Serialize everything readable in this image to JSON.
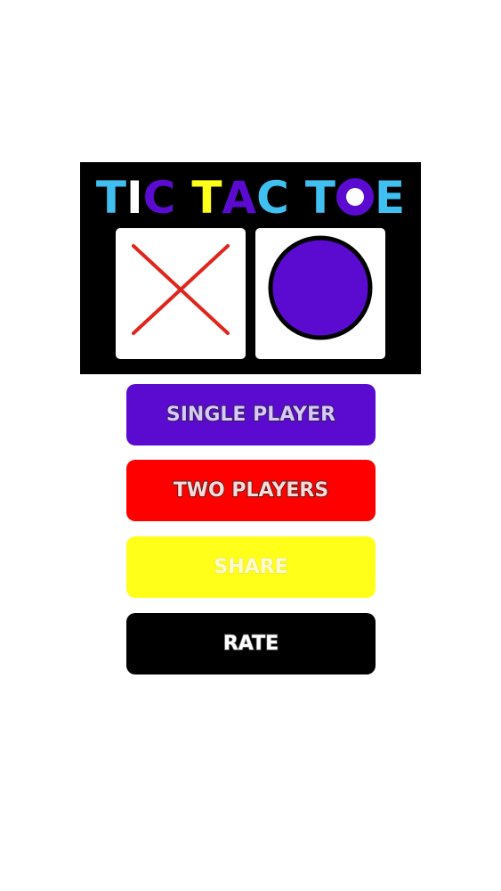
{
  "logo": {
    "title_letters": [
      {
        "char": "T",
        "color": "#3fc0f0"
      },
      {
        "char": "I",
        "color": "#ffffff"
      },
      {
        "char": "C",
        "color": "#5b0bd0"
      },
      {
        "char": "T",
        "color": "#ffff1a"
      },
      {
        "char": "A",
        "color": "#5b0bd0"
      },
      {
        "char": "C",
        "color": "#3fc0f0"
      },
      {
        "char": "T",
        "color": "#3fc0f0"
      },
      {
        "char": "O",
        "color": "#5b0bd0"
      },
      {
        "char": "E",
        "color": "#3fc0f0"
      }
    ],
    "word1": [
      "T",
      "I",
      "C"
    ],
    "word2": [
      "T",
      "A",
      "C"
    ],
    "word3": [
      "T",
      "O",
      "E"
    ],
    "tile_x_icon": "x-mark-icon",
    "tile_o_icon": "circle-mark-icon",
    "colors": {
      "x_mark": "#e0261c",
      "o_mark": "#5b0bd0",
      "background": "#000000"
    }
  },
  "menu": {
    "single_player": "SINGLE PLAYER",
    "two_players": "TWO PLAYERS",
    "share": "SHARE",
    "rate": "RATE"
  },
  "colors": {
    "single_player": "#5b0bd0",
    "two_players": "#fe0000",
    "share": "#ffff1a",
    "rate": "#000000"
  }
}
